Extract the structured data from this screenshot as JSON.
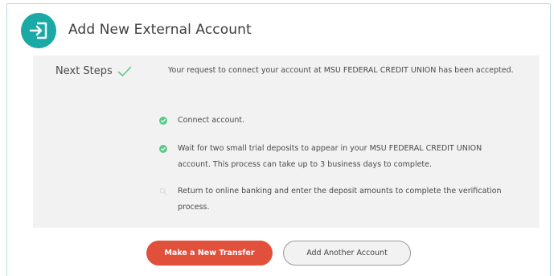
{
  "header": {
    "title": "Add New External Account",
    "icon": "sign-in-icon",
    "accent_color": "#1ba9a6"
  },
  "panel": {
    "label": "Next Steps",
    "intro": "Your request to connect your account at MSU FEDERAL CREDIT UNION has been accepted.",
    "steps": [
      {
        "status": "complete",
        "icon": "check-circle-icon",
        "line1": "Connect account.",
        "line2": ""
      },
      {
        "status": "complete",
        "icon": "check-circle-icon",
        "line1": "Wait for two small trial deposits to appear in your MSU FEDERAL CREDIT UNION",
        "line2": "account. This process can take up to 3 business days to complete."
      },
      {
        "status": "pending",
        "icon": "search-icon",
        "line1": "Return to online banking and enter the deposit amounts to complete the verification",
        "line2": "process."
      }
    ]
  },
  "actions": {
    "primary_label": "Make a New Transfer",
    "secondary_label": "Add Another Account",
    "primary_color": "#e0503a"
  }
}
